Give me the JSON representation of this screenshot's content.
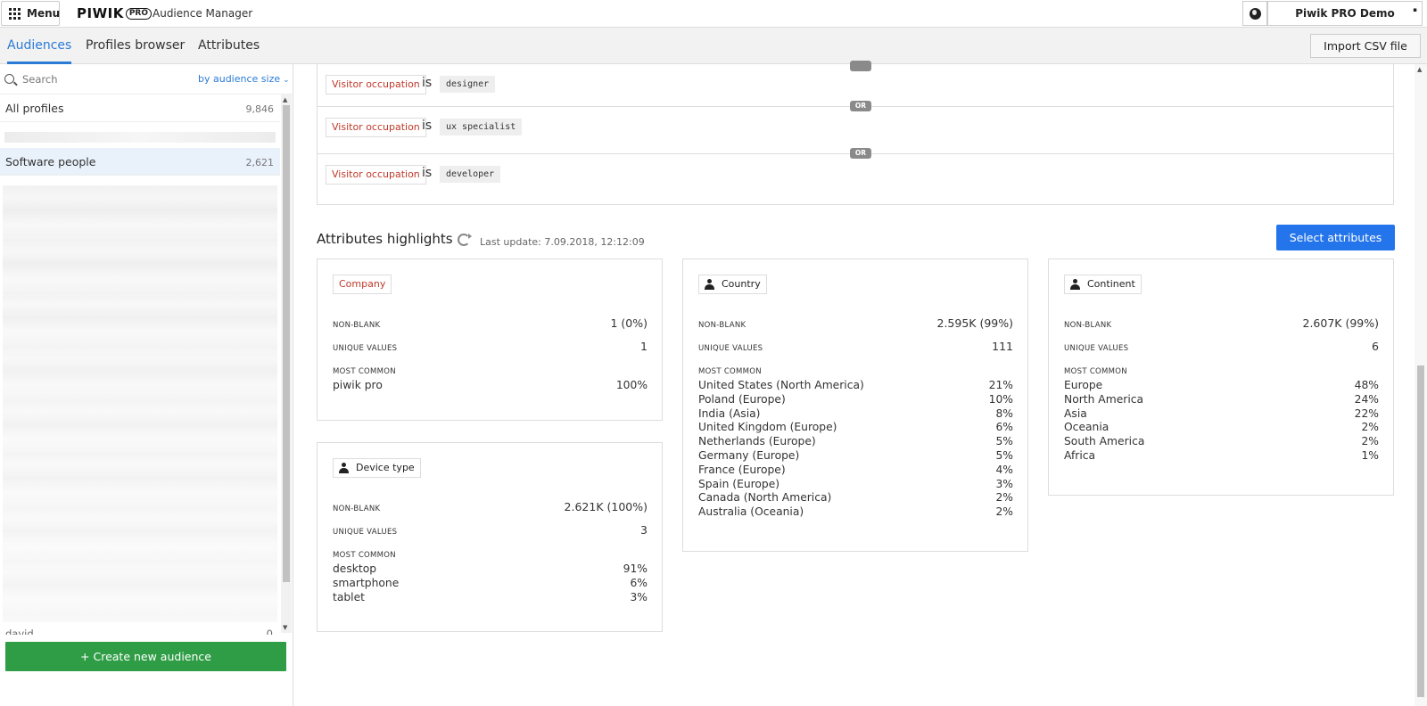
{
  "topbar": {
    "menu_label": "Menu",
    "logo_text": "PIWIK",
    "logo_badge": "PRO",
    "app_name": "Audience Manager",
    "site_name": "Piwik PRO Demo"
  },
  "tabs": [
    {
      "label": "Audiences",
      "active": true
    },
    {
      "label": "Profiles browser",
      "active": false
    },
    {
      "label": "Attributes",
      "active": false
    }
  ],
  "import_label": "Import CSV file",
  "sidebar": {
    "search_placeholder": "Search",
    "sort_label": "by audience size",
    "audiences": [
      {
        "name": "All profiles",
        "count": "9,846"
      },
      {
        "name": "Software people",
        "count": "2,621",
        "selected": true
      }
    ],
    "partial_item": {
      "name": "david",
      "count": "0"
    },
    "create_label": "+ Create new audience"
  },
  "rules": [
    {
      "attribute": "Visitor occupation",
      "operator": "is",
      "value": "designer"
    },
    {
      "attribute": "Visitor occupation",
      "operator": "is",
      "value": "ux specialist"
    },
    {
      "attribute": "Visitor occupation",
      "operator": "is",
      "value": "developer"
    }
  ],
  "or_label": "OR",
  "highlights": {
    "title": "Attributes highlights",
    "last_update": "Last update: 7.09.2018, 12:12:09",
    "select_label": "Select attributes",
    "labels": {
      "non_blank": "NON-BLANK",
      "unique_values": "UNIQUE VALUES",
      "most_common": "MOST COMMON"
    },
    "cards": {
      "company": {
        "name": "Company",
        "non_blank": "1 (0%)",
        "unique_values": "1",
        "most_common": [
          [
            "piwik pro",
            "100%"
          ]
        ]
      },
      "device_type": {
        "name": "Device type",
        "non_blank": "2.621K (100%)",
        "unique_values": "3",
        "most_common": [
          [
            "desktop",
            "91%"
          ],
          [
            "smartphone",
            "6%"
          ],
          [
            "tablet",
            "3%"
          ]
        ]
      },
      "country": {
        "name": "Country",
        "non_blank": "2.595K (99%)",
        "unique_values": "111",
        "most_common": [
          [
            "United States (North America)",
            "21%"
          ],
          [
            "Poland (Europe)",
            "10%"
          ],
          [
            "India (Asia)",
            "8%"
          ],
          [
            "United Kingdom (Europe)",
            "6%"
          ],
          [
            "Netherlands (Europe)",
            "5%"
          ],
          [
            "Germany (Europe)",
            "5%"
          ],
          [
            "France (Europe)",
            "4%"
          ],
          [
            "Spain (Europe)",
            "3%"
          ],
          [
            "Canada (North America)",
            "2%"
          ],
          [
            "Australia (Oceania)",
            "2%"
          ]
        ]
      },
      "continent": {
        "name": "Continent",
        "non_blank": "2.607K (99%)",
        "unique_values": "6",
        "most_common": [
          [
            "Europe",
            "48%"
          ],
          [
            "North America",
            "24%"
          ],
          [
            "Asia",
            "22%"
          ],
          [
            "Oceania",
            "2%"
          ],
          [
            "South America",
            "2%"
          ],
          [
            "Africa",
            "1%"
          ]
        ]
      }
    }
  }
}
